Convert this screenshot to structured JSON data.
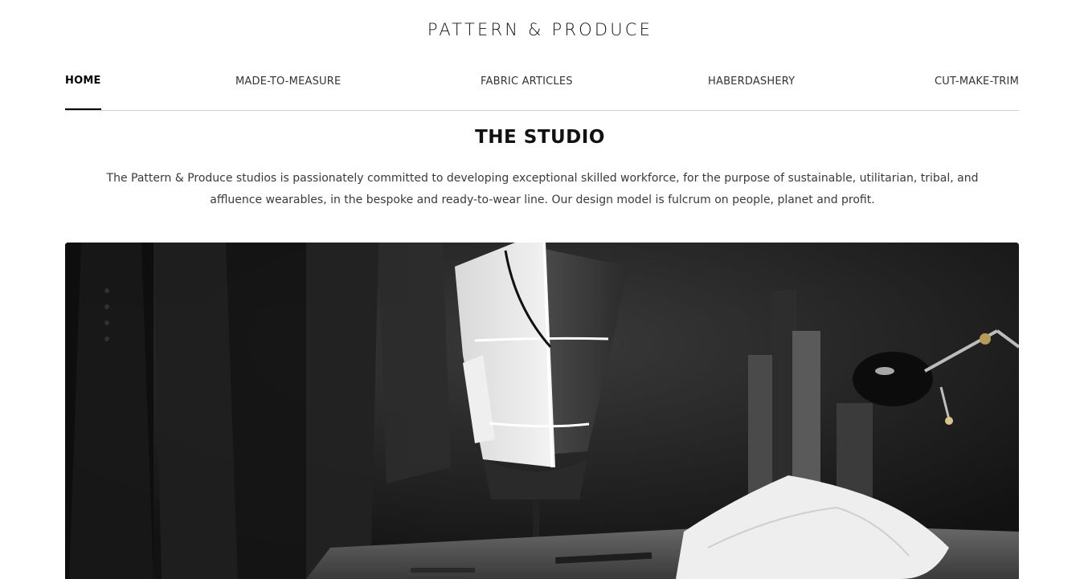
{
  "brand": {
    "logo_text": "PATTERN & PRODUCE"
  },
  "nav": {
    "items": [
      {
        "label": "HOME",
        "active": true
      },
      {
        "label": "MADE-TO-MEASURE",
        "active": false
      },
      {
        "label": "FABRIC ARTICLES",
        "active": false
      },
      {
        "label": "HABERDASHERY",
        "active": false
      },
      {
        "label": "CUT-MAKE-TRIM",
        "active": false
      }
    ]
  },
  "studio": {
    "title": "THE STUDIO",
    "description": "The Pattern & Produce studios is passionately committed to developing exceptional skilled workforce, for the purpose of sustainable, utilitarian, tribal, and affluence wearables, in the bespoke and ready-to-wear line. Our design model is fulcrum on people, planet and profit."
  }
}
